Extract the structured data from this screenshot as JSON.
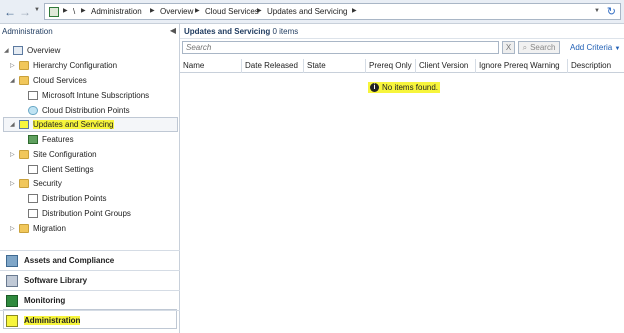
{
  "window": {
    "title": "Administration"
  },
  "address_bar": {
    "root_glyph": "\\",
    "breadcrumbs": [
      "Administration",
      "Overview",
      "Cloud Services",
      "Updates and Servicing"
    ]
  },
  "nav": {
    "pane_title": "Administration",
    "tree": [
      {
        "label": "Overview",
        "icon": "overview-grid-icon"
      },
      {
        "label": "Hierarchy Configuration",
        "icon": "folder-icon"
      },
      {
        "label": "Cloud Services",
        "icon": "folder-icon"
      },
      {
        "label": "Microsoft Intune Subscriptions",
        "icon": "document-icon"
      },
      {
        "label": "Cloud Distribution Points",
        "icon": "cloud-icon"
      },
      {
        "label": "Updates and Servicing",
        "icon": "update-icon"
      },
      {
        "label": "Features",
        "icon": "features-icon"
      },
      {
        "label": "Site Configuration",
        "icon": "folder-icon"
      },
      {
        "label": "Client Settings",
        "icon": "client-settings-icon"
      },
      {
        "label": "Security",
        "icon": "folder-icon"
      },
      {
        "label": "Distribution Points",
        "icon": "distribution-point-icon"
      },
      {
        "label": "Distribution Point Groups",
        "icon": "distribution-group-icon"
      },
      {
        "label": "Migration",
        "icon": "folder-icon"
      }
    ],
    "workspaces": [
      {
        "label": "Assets and Compliance",
        "icon": "assets-icon"
      },
      {
        "label": "Software Library",
        "icon": "software-library-icon"
      },
      {
        "label": "Monitoring",
        "icon": "monitoring-icon"
      },
      {
        "label": "Administration",
        "icon": "administration-icon"
      }
    ]
  },
  "main": {
    "title": "Updates and Servicing",
    "count": "0 items",
    "search": {
      "placeholder": "Search",
      "button": "Search",
      "clear": "X",
      "add_criteria": "Add Criteria"
    },
    "columns": [
      "Name",
      "Date Released",
      "State",
      "Prereq Only",
      "Client Version",
      "Ignore Prereq Warning",
      "Description"
    ],
    "empty_message": "No items found."
  },
  "colors": {
    "highlight": "#f7f53c",
    "link": "#1f5fb5"
  }
}
